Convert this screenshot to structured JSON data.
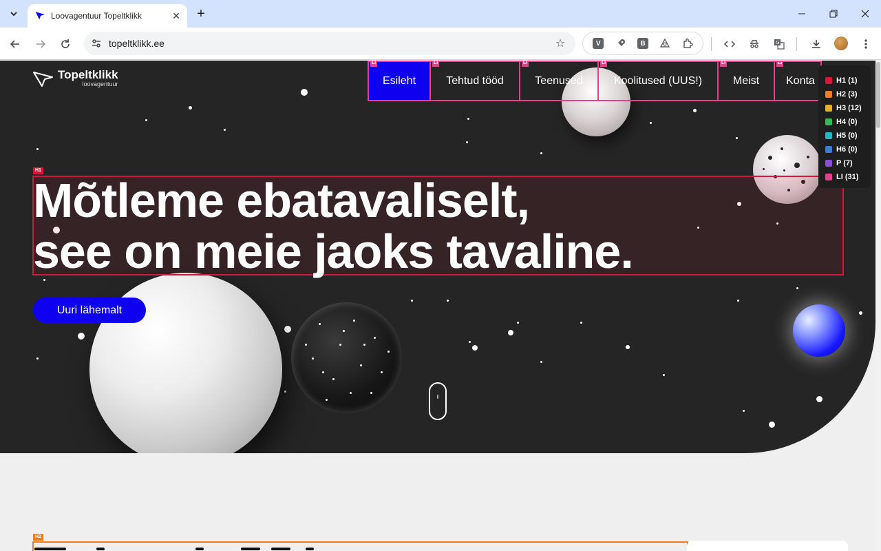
{
  "browser": {
    "tab_title": "Loovagentuur Topeltklikk",
    "url": "topeltklikk.ee",
    "extensions": [
      {
        "label": "V",
        "icon": "v-extension-icon"
      },
      {
        "label": "",
        "icon": "rocket-icon"
      },
      {
        "label": "B",
        "icon": "b-extension-icon"
      },
      {
        "label": "",
        "icon": "eye-extension-icon"
      },
      {
        "label": "",
        "icon": "puzzle-icon"
      }
    ]
  },
  "site": {
    "logo_title": "Topeltklikk",
    "logo_subtitle": "loovagentuur",
    "nav": [
      {
        "label": "Esileht",
        "badge": "LI",
        "active": true
      },
      {
        "label": "Tehtud tööd",
        "badge": "LI"
      },
      {
        "label": "Teenused",
        "badge": "LI"
      },
      {
        "label": "Koolitused (UUS!)",
        "badge": "LI"
      },
      {
        "label": "Meist",
        "badge": "LI"
      },
      {
        "label": "Konta",
        "badge": "LI"
      }
    ],
    "h1_badge": "H1",
    "headline_line1": "Mõtleme ebatavaliselt,",
    "headline_line2": "see on meie jaoks tavaline.",
    "cta_label": "Uuri lähemalt",
    "h2_badge": "H2"
  },
  "heading_legend": [
    {
      "label": "H1 (1)",
      "color": "#dc143c"
    },
    {
      "label": "H2 (3)",
      "color": "#f07c20"
    },
    {
      "label": "H3 (12)",
      "color": "#e6b020"
    },
    {
      "label": "H4 (0)",
      "color": "#2ebd59"
    },
    {
      "label": "H5 (0)",
      "color": "#1eb8c8"
    },
    {
      "label": "H6 (0)",
      "color": "#3b7ddd"
    },
    {
      "label": "P (7)",
      "color": "#8a4dd6"
    },
    {
      "label": "LI (31)",
      "color": "#e83e8c"
    }
  ],
  "colors": {
    "hero_bg": "#252525",
    "brand_blue": "#1000f0",
    "li_outline": "#e83e8c",
    "h1_outline": "#dc143c",
    "h2_outline": "#f07c20"
  }
}
